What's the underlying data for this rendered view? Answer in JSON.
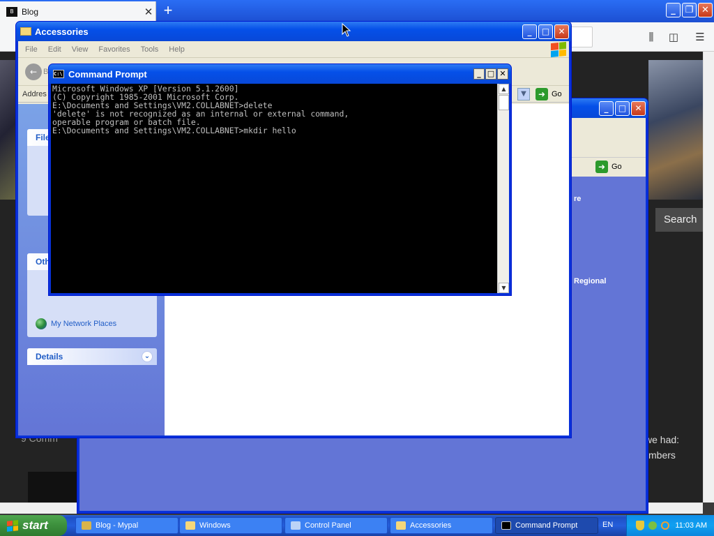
{
  "browser": {
    "tab_title": "Blog",
    "favicon_text": "B",
    "new_tab": "+",
    "search_button": "Search",
    "right_texts": [
      "re",
      "Regional",
      "we had:",
      "mbers"
    ],
    "left_text": "9 Comm"
  },
  "accessories_window": {
    "title": "Accessories",
    "menu": [
      "File",
      "Edit",
      "View",
      "Favorites",
      "Tools",
      "Help"
    ],
    "address_label": "Addres",
    "back_label": "B",
    "go_label": "Go",
    "task_panels": {
      "file_head": "File",
      "other_head": "Oth",
      "network_link": "My Network Places",
      "details_head": "Details"
    }
  },
  "windows_window": {
    "go_label": "Go"
  },
  "cmd_window": {
    "title": "Command Prompt",
    "lines": [
      "Microsoft Windows XP [Version 5.1.2600]",
      "(C) Copyright 1985-2001 Microsoft Corp.",
      "",
      "E:\\Documents and Settings\\VM2.COLLABNET>delete",
      "'delete' is not recognized as an internal or external command,",
      "operable program or batch file.",
      "",
      "E:\\Documents and Settings\\VM2.COLLABNET>mkdir hello"
    ]
  },
  "taskbar": {
    "start_label": "start",
    "tasks": [
      {
        "label": "Blog - Mypal",
        "active": false
      },
      {
        "label": "Windows",
        "active": false
      },
      {
        "label": "Control Panel",
        "active": false
      },
      {
        "label": "Accessories",
        "active": false
      },
      {
        "label": "Command Prompt",
        "active": true
      }
    ],
    "language": "EN",
    "clock": "11:03 AM"
  },
  "colors": {
    "xp_title_blue": "#0550e8",
    "start_green": "#3c8f3c",
    "taskbar_blue": "#245edb",
    "tray_blue": "#10a0f0"
  }
}
